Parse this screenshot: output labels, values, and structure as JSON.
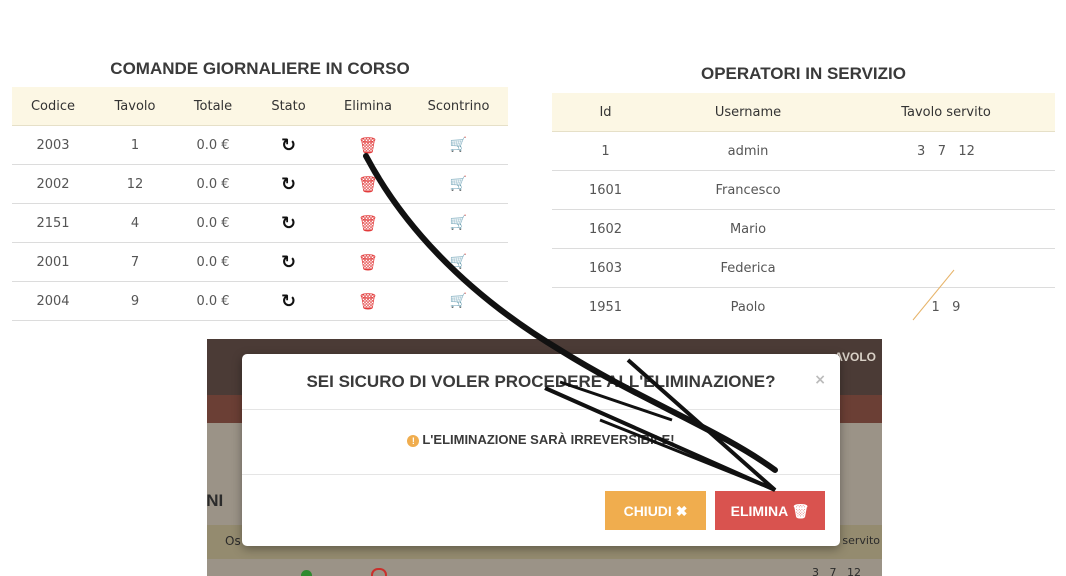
{
  "comande": {
    "title": "COMANDE GIORNALIERE IN CORSO",
    "headers": [
      "Codice",
      "Tavolo",
      "Totale",
      "Stato",
      "Elimina",
      "Scontrino"
    ],
    "rows": [
      {
        "codice": "2003",
        "tavolo": "1",
        "totale": "0.0 €"
      },
      {
        "codice": "2002",
        "tavolo": "12",
        "totale": "0.0 €"
      },
      {
        "codice": "2151",
        "tavolo": "4",
        "totale": "0.0 €"
      },
      {
        "codice": "2001",
        "tavolo": "7",
        "totale": "0.0 €"
      },
      {
        "codice": "2004",
        "tavolo": "9",
        "totale": "0.0 €"
      }
    ],
    "icons": {
      "stato": "refresh-icon",
      "elimina": "trash-icon",
      "scontrino": "cart-icon"
    }
  },
  "operatori": {
    "title": "OPERATORI IN SERVIZIO",
    "headers": [
      "Id",
      "Username",
      "Tavolo servito"
    ],
    "rows": [
      {
        "id": "1",
        "username": "admin",
        "tavoli": "3   7   12"
      },
      {
        "id": "1601",
        "username": "Francesco",
        "tavoli": ""
      },
      {
        "id": "1602",
        "username": "Mario",
        "tavoli": ""
      },
      {
        "id": "1603",
        "username": "Federica",
        "tavoli": ""
      },
      {
        "id": "1951",
        "username": "Paolo",
        "tavoli": "1   9"
      }
    ]
  },
  "background": {
    "nav_text": "AVOLO",
    "section_title": "ONI",
    "header_left": "Os",
    "header_right": "servito",
    "bottom_row": "3   7   12"
  },
  "modal": {
    "title": "SEI SICURO DI VOLER PROCEDERE ALL'ELIMINAZIONE?",
    "close_glyph": "×",
    "warning_icon": "exclamation-circle-icon",
    "warning": "L'ELIMINAZIONE SARÀ IRREVERSIBILE!",
    "cancel_label": "CHIUDI ✖",
    "confirm_label": "ELIMINA 🗑"
  },
  "colors": {
    "header_bg": "#fcf7e4",
    "trash": "#e23b3b",
    "cart": "#2d6db5",
    "cancel_btn": "#f0ad4e",
    "confirm_btn": "#d9534f"
  }
}
